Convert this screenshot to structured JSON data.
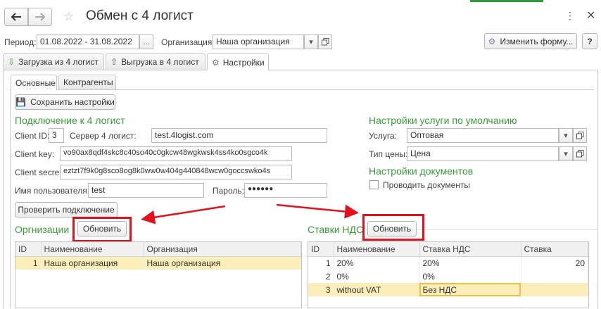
{
  "window": {
    "title": "Обмен с 4 логист"
  },
  "filters": {
    "period_label": "Период:",
    "period_value": "01.08.2022 - 31.08.2022",
    "period_dots": "...",
    "org_label": "Организация:",
    "org_value": "Наша организация",
    "change_form_label": "Изменить форму...",
    "help_label": "?"
  },
  "main_tabs": [
    {
      "label": "Загрузка из 4 логист"
    },
    {
      "label": "Выгрузка в 4 логист"
    },
    {
      "label": "Настройки"
    }
  ],
  "sub_tabs": [
    {
      "label": "Основные"
    },
    {
      "label": "Контрагенты"
    }
  ],
  "save_settings_label": "Сохранить настройки",
  "connection": {
    "title": "Подключение к 4 логист",
    "client_id_label": "Client ID:",
    "client_id": "3",
    "server_label": "Сервер 4 логист:",
    "server": "test.4logist.com",
    "client_key_label": "Client key:",
    "client_key": "vo90ax8qdf4skc8c40so40c0gkcw48wgkwsk4ss4ko0sgco4k",
    "client_secret_label": "Client secret:",
    "client_secret": "eztzt7f9k0g8sco8og8k0ww0w404g440848wcw0goccswko4s",
    "username_label": "Имя пользователя:",
    "username": "test",
    "password_label": "Пароль:",
    "password": "●●●●●●",
    "check_label": "Проверить подключение"
  },
  "service_defaults": {
    "title": "Настройки услуги по умолчанию",
    "service_label": "Услуга:",
    "service_value": "Оптовая",
    "price_type_label": "Тип цены:",
    "price_type_value": "Цена"
  },
  "docs_settings": {
    "title": "Настройки документов",
    "post_docs_label": "Проводить документы"
  },
  "orgs": {
    "title": "Оргнизации",
    "refresh_label": "Обновить",
    "columns": [
      "ID",
      "Наименование",
      "Организация"
    ],
    "rows": [
      {
        "id": "1",
        "name": "Наша организация",
        "org": "Наша организация"
      }
    ]
  },
  "vat": {
    "title": "Ставки НДС",
    "refresh_label": "Обновить",
    "columns": [
      "ID",
      "Наименование",
      "Ставка НДС",
      "Ставка"
    ],
    "rows": [
      {
        "id": "1",
        "name": "20%",
        "vat": "20%",
        "rate": "20"
      },
      {
        "id": "2",
        "name": "0%",
        "vat": "0%",
        "rate": ""
      },
      {
        "id": "3",
        "name": "without VAT",
        "vat": "Без НДС",
        "rate": ""
      }
    ]
  }
}
